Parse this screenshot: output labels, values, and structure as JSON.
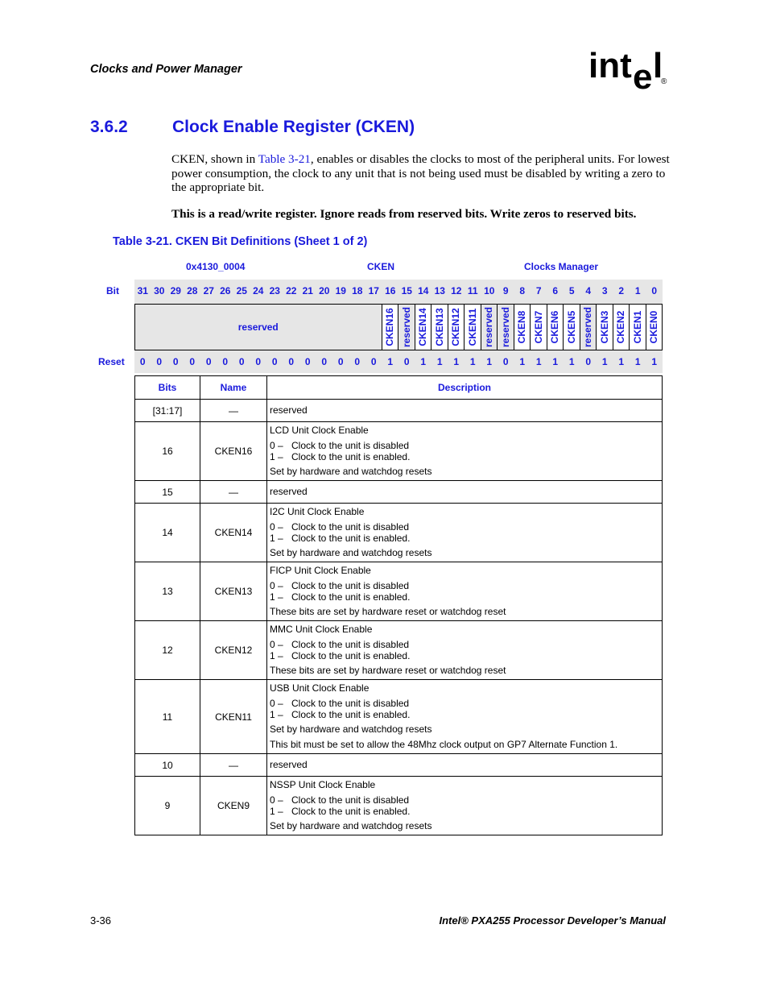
{
  "header": {
    "running_title": "Clocks and Power Manager",
    "logo_text": "intel",
    "logo_mark": "®"
  },
  "section": {
    "number": "3.6.2",
    "title": "Clock Enable Register (CKEN)"
  },
  "body": {
    "para1_before": "CKEN, shown in ",
    "para1_link": "Table 3-21",
    "para1_after": ", enables or disables the clocks to most of the peripheral units. For lowest power consumption, the clock to any unit that is not being used must be disabled by writing a zero to the appropriate bit.",
    "para2": "This is a read/write register. Ignore reads from reserved bits. Write zeros to reserved bits."
  },
  "table_caption": "Table 3-21. CKEN Bit Definitions (Sheet 1 of 2)",
  "register": {
    "address": "0x4130_0004",
    "name": "CKEN",
    "unit": "Clocks Manager",
    "bit_label": "Bit",
    "reset_label": "Reset",
    "bits": [
      "31",
      "30",
      "29",
      "28",
      "27",
      "26",
      "25",
      "24",
      "23",
      "22",
      "21",
      "20",
      "19",
      "18",
      "17",
      "16",
      "15",
      "14",
      "13",
      "12",
      "11",
      "10",
      "9",
      "8",
      "7",
      "6",
      "5",
      "4",
      "3",
      "2",
      "1",
      "0"
    ],
    "reset_values": [
      "0",
      "0",
      "0",
      "0",
      "0",
      "0",
      "0",
      "0",
      "0",
      "0",
      "0",
      "0",
      "0",
      "0",
      "0",
      "1",
      "0",
      "1",
      "1",
      "1",
      "1",
      "1",
      "0",
      "1",
      "1",
      "1",
      "1",
      "0",
      "1",
      "1",
      "1",
      "1"
    ],
    "fields": [
      {
        "label": "reserved",
        "msb": 31,
        "lsb": 17,
        "reserved": true
      },
      {
        "label": "CKEN16",
        "msb": 16,
        "lsb": 16,
        "reserved": false
      },
      {
        "label": "reserved",
        "msb": 15,
        "lsb": 15,
        "reserved": true
      },
      {
        "label": "CKEN14",
        "msb": 14,
        "lsb": 14,
        "reserved": false
      },
      {
        "label": "CKEN13",
        "msb": 13,
        "lsb": 13,
        "reserved": false
      },
      {
        "label": "CKEN12",
        "msb": 12,
        "lsb": 12,
        "reserved": false
      },
      {
        "label": "CKEN11",
        "msb": 11,
        "lsb": 11,
        "reserved": false
      },
      {
        "label": "reserved",
        "msb": 10,
        "lsb": 10,
        "reserved": true
      },
      {
        "label": "reserved",
        "msb": 9,
        "lsb": 9,
        "reserved": true
      },
      {
        "label": "CKEN8",
        "msb": 8,
        "lsb": 8,
        "reserved": false
      },
      {
        "label": "CKEN7",
        "msb": 7,
        "lsb": 7,
        "reserved": false
      },
      {
        "label": "CKEN6",
        "msb": 6,
        "lsb": 6,
        "reserved": false
      },
      {
        "label": "CKEN5",
        "msb": 5,
        "lsb": 5,
        "reserved": false
      },
      {
        "label": "reserved",
        "msb": 4,
        "lsb": 4,
        "reserved": true
      },
      {
        "label": "CKEN3",
        "msb": 3,
        "lsb": 3,
        "reserved": false
      },
      {
        "label": "CKEN2",
        "msb": 2,
        "lsb": 2,
        "reserved": false
      },
      {
        "label": "CKEN1",
        "msb": 1,
        "lsb": 1,
        "reserved": false
      },
      {
        "label": "CKEN0",
        "msb": 0,
        "lsb": 0,
        "reserved": false
      }
    ]
  },
  "defs_table": {
    "headers": {
      "bits": "Bits",
      "name": "Name",
      "description": "Description"
    },
    "rows": [
      {
        "bits": "[31:17]",
        "name": "—",
        "title": "reserved",
        "options": [],
        "notes": []
      },
      {
        "bits": "16",
        "name": "CKEN16",
        "title": "LCD Unit Clock Enable",
        "options": [
          {
            "key": "0 –",
            "text": "Clock to the unit is disabled"
          },
          {
            "key": "1 –",
            "text": "Clock to the unit is enabled."
          }
        ],
        "notes": [
          "Set by hardware and watchdog resets"
        ]
      },
      {
        "bits": "15",
        "name": "—",
        "title": "reserved",
        "options": [],
        "notes": []
      },
      {
        "bits": "14",
        "name": "CKEN14",
        "title": "I2C Unit Clock Enable",
        "options": [
          {
            "key": "0 –",
            "text": "Clock to the unit is disabled"
          },
          {
            "key": "1 –",
            "text": "Clock to the unit is enabled."
          }
        ],
        "notes": [
          "Set by hardware and watchdog resets"
        ]
      },
      {
        "bits": "13",
        "name": "CKEN13",
        "title": "FICP Unit Clock Enable",
        "options": [
          {
            "key": "0 –",
            "text": "Clock to the unit is disabled"
          },
          {
            "key": "1 –",
            "text": "Clock to the unit is enabled."
          }
        ],
        "notes": [
          "These bits are set by hardware reset or watchdog reset"
        ]
      },
      {
        "bits": "12",
        "name": "CKEN12",
        "title": "MMC Unit Clock Enable",
        "options": [
          {
            "key": "0 –",
            "text": "Clock to the unit is disabled"
          },
          {
            "key": "1 –",
            "text": "Clock to the unit is enabled."
          }
        ],
        "notes": [
          "These bits are set by hardware reset or watchdog reset"
        ]
      },
      {
        "bits": "11",
        "name": "CKEN11",
        "title": "USB Unit Clock Enable",
        "options": [
          {
            "key": "0 –",
            "text": "Clock to the unit is disabled"
          },
          {
            "key": "1 –",
            "text": "Clock to the unit is enabled."
          }
        ],
        "notes": [
          "Set by hardware and watchdog resets",
          "This bit must be set to allow the 48Mhz clock output on GP7 Alternate Function 1."
        ]
      },
      {
        "bits": "10",
        "name": "—",
        "title": "reserved",
        "options": [],
        "notes": []
      },
      {
        "bits": "9",
        "name": "CKEN9",
        "title": "NSSP Unit Clock Enable",
        "options": [
          {
            "key": "0 –",
            "text": "Clock to the unit is disabled"
          },
          {
            "key": "1 –",
            "text": "Clock to the unit is enabled."
          }
        ],
        "notes": [
          "Set by hardware and watchdog resets"
        ]
      }
    ]
  },
  "footer": {
    "page_number": "3-36",
    "manual_title": "Intel® PXA255 Processor Developer’s Manual"
  }
}
